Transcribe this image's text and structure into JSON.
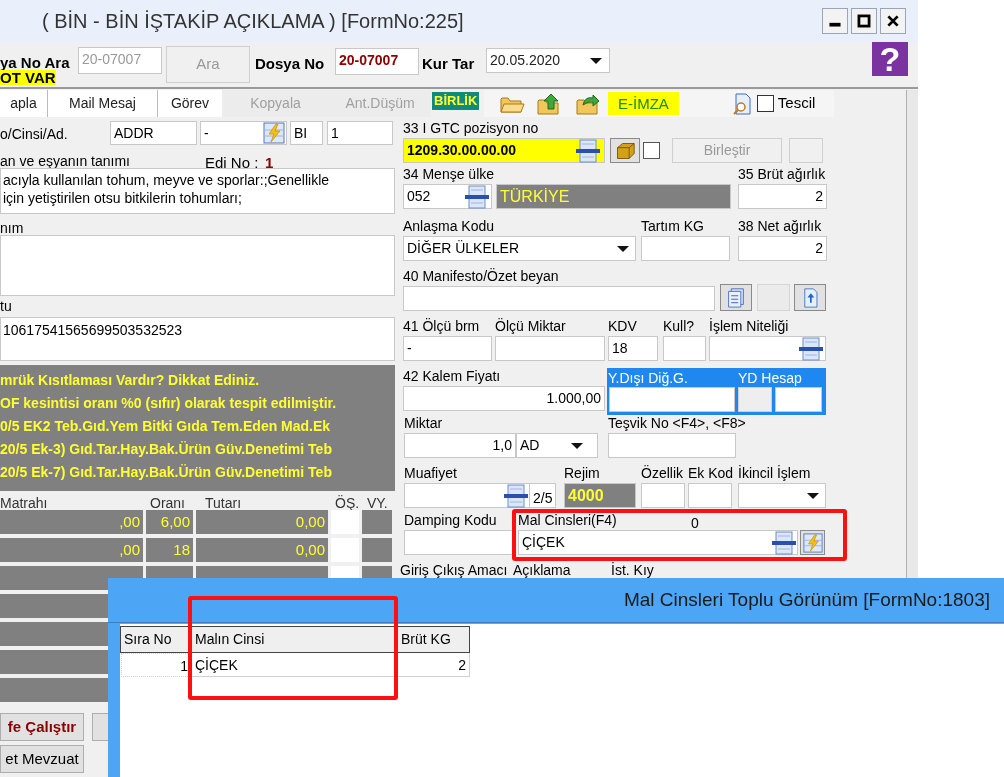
{
  "window": {
    "title": "( BİN - BİN İŞTAKİP AÇIKLAMA ) [FormNo:225]"
  },
  "help_button": "?",
  "header": {
    "search_label": "ya No Ara",
    "search_value": "20-07007",
    "search_button": "Ara",
    "file_label": "Dosya No",
    "file_value": "20-07007",
    "rate_date_label": "Kur Tar",
    "rate_date_value": "20.05.2020",
    "notice": "OT VAR"
  },
  "toolbar": {
    "items": [
      {
        "label": "apla",
        "disabled": false
      },
      {
        "label": "Mail Mesaj",
        "disabled": false
      },
      {
        "label": "Görev",
        "disabled": false
      },
      {
        "label": "Kopyala",
        "disabled": true
      },
      {
        "label": "Ant.Düşüm",
        "disabled": true
      }
    ],
    "union_badge": "BİRLİK",
    "signature_button": "E-İMZA",
    "register": {
      "label": "Tescil",
      "checked": false
    }
  },
  "left_form": {
    "code_label": "o/Cinsi/Ad.",
    "code_fields": [
      "ADDR",
      "-",
      "BI",
      "1"
    ],
    "description_label": "an ve eşyanın tanımı",
    "edi_label": "Edi No :",
    "edi_value": "1",
    "description_lines": [
      "acıyla kullanılan tohum, meyve ve sporlar:;Genellikle",
      "için yetiştirilen otsu bitkilerin tohumları;"
    ],
    "second_label": "nım",
    "third_label": "tu",
    "third_value": "10617541565699503532523",
    "warnings": [
      "mrük Kısıtlaması Vardır? Dikkat Ediniz.",
      "OF kesintisi oranı %0 (sıfır) olarak tespit edilmiştir.",
      "0/5 EK2 Teb.Gıd.Yem Bitki Gıda Tem.Eden Mad.Ek",
      "20/5 Ek-3) Gıd.Tar.Hay.Bak.Ürün Güv.Denetimi Teb",
      "20/5 Ek-7) Gıd.Tar.Hay.Bak.Ürün Güv.Denetimi Teb"
    ],
    "tax_table": {
      "columns": [
        "Matrahı",
        "Oranı",
        "Tutarı",
        "ÖŞ.",
        "VY."
      ],
      "rows": [
        {
          "base": ",00",
          "rate": "6,00",
          "amount": "0,00"
        },
        {
          "base": ",00",
          "rate": "18",
          "amount": "0,00"
        }
      ]
    },
    "buttons": [
      "fe Çalıştır",
      "et Mevzuat"
    ]
  },
  "right_form": {
    "rows": [
      {
        "cells": [
          {
            "kind": "tariff",
            "label": "33 I GTC pozisyon no",
            "value": "1209.30.00.00.00"
          },
          {
            "kind": "box_button"
          },
          {
            "kind": "checkbox",
            "checked": false
          },
          {
            "kind": "button",
            "label": "Birleştir",
            "disabled": true
          },
          {
            "kind": "dots_button"
          }
        ]
      },
      {
        "cells": [
          {
            "kind": "lookup",
            "label": "34 Menşe ülke",
            "value": "052"
          },
          {
            "kind": "country",
            "value": "TÜRKİYE"
          },
          {
            "kind": "number",
            "label": "35 Brüt ağırlık",
            "value": "2"
          }
        ]
      },
      {
        "cells": [
          {
            "kind": "combo",
            "label": "Anlaşma Kodu",
            "value": "DİĞER ÜLKELER"
          },
          {
            "kind": "text",
            "label": "Tartım KG"
          },
          {
            "kind": "number",
            "label": "38 Net ağırlık",
            "value": "2"
          }
        ]
      },
      {
        "cells": [
          {
            "kind": "text",
            "label": "40 Manifesto/Özet beyan"
          },
          {
            "kind": "list_button"
          },
          {
            "kind": "blank_button"
          },
          {
            "kind": "upload_button"
          }
        ]
      },
      {
        "cells": [
          {
            "kind": "text",
            "label": "41 Ölçü brm",
            "value": "-"
          },
          {
            "kind": "text",
            "label": "Ölçü Miktar"
          },
          {
            "kind": "text",
            "label": "KDV",
            "value": "18"
          },
          {
            "kind": "text",
            "label": "Kull?"
          },
          {
            "kind": "lookup",
            "label": "İşlem Niteliği"
          }
        ]
      },
      {
        "cells": [
          {
            "kind": "number",
            "label": "42 Kalem Fiyatı",
            "value": "1.000,00"
          },
          {
            "kind": "foreign_panel",
            "labels": [
              "Y.Dışı Diğ.G.",
              "YD Hesap"
            ]
          }
        ]
      },
      {
        "cells": [
          {
            "kind": "quantity",
            "label": "Miktar",
            "value": "1,0",
            "unit": "AD"
          },
          {
            "kind": "text",
            "label": "Teşvik No <F4>, <F8>"
          }
        ]
      },
      {
        "cells": [
          {
            "kind": "exemption",
            "label": "Muafiyet",
            "suffix": "2/5"
          },
          {
            "kind": "regime",
            "label": "Rejim",
            "value": "4000"
          },
          {
            "kind": "text",
            "label": "Özellik"
          },
          {
            "kind": "text",
            "label": "Ek Kod"
          },
          {
            "kind": "combo",
            "label": "İkincil İşlem"
          }
        ]
      },
      {
        "cells": [
          {
            "kind": "text",
            "label": "Damping Kodu"
          },
          {
            "kind": "goods",
            "label": "Mal Cinsleri(F4)",
            "count": "0",
            "value": "ÇİÇEK"
          }
        ]
      },
      {
        "cells": [
          {
            "kind": "label",
            "label": "Giriş Çıkış Amacı"
          },
          {
            "kind": "label",
            "label": "Açıklama"
          },
          {
            "kind": "label",
            "label": "İst. Kıy"
          }
        ]
      }
    ]
  },
  "popup": {
    "title": "Mal Cinsleri Toplu Görünüm [FormNo:1803]",
    "columns": [
      "Sıra No",
      "Malın Cinsi",
      "Brüt KG"
    ],
    "rows": [
      {
        "cells": [
          "1",
          "ÇİÇEK",
          "2"
        ]
      }
    ]
  }
}
